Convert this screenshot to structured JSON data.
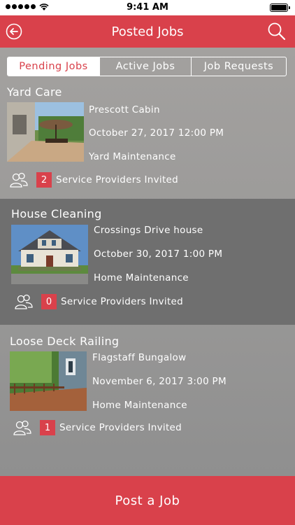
{
  "status_bar": {
    "time": "9:41 AM"
  },
  "header": {
    "title": "Posted Jobs"
  },
  "tabs": [
    {
      "label": "Pending Jobs",
      "active": true
    },
    {
      "label": "Active Jobs",
      "active": false
    },
    {
      "label": "Job Requests",
      "active": false
    }
  ],
  "jobs": [
    {
      "title": "Yard Care",
      "location": "Prescott Cabin",
      "datetime": "October 27, 2017 12:00 PM",
      "category": "Yard Maintenance",
      "invited_count": "2",
      "invited_label": "Service Providers Invited"
    },
    {
      "title": "House Cleaning",
      "location": "Crossings Drive house",
      "datetime": "October 30, 2017 1:00 PM",
      "category": "Home Maintenance",
      "invited_count": "0",
      "invited_label": "Service Providers Invited"
    },
    {
      "title": "Loose Deck Railing",
      "location": "Flagstaff Bungalow",
      "datetime": "November 6, 2017 3:00 PM",
      "category": "Home Maintenance",
      "invited_count": "1",
      "invited_label": "Service Providers Invited"
    }
  ],
  "footer": {
    "post_job_label": "Post a Job"
  },
  "colors": {
    "accent": "#d9414b",
    "highlight_row": "#6f6f6f"
  }
}
